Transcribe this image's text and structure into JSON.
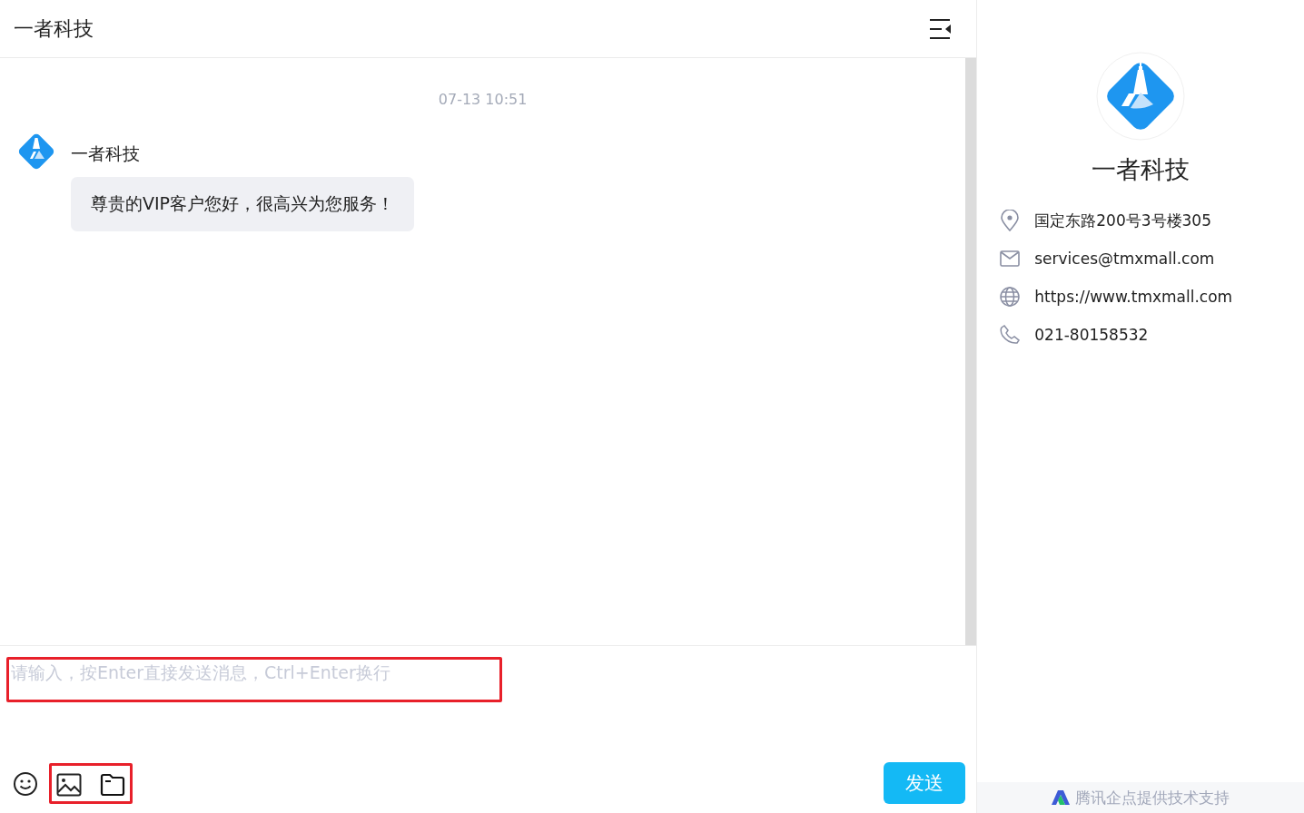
{
  "header": {
    "title": "一者科技"
  },
  "chat": {
    "timestamp": "07-13 10:51",
    "messages": [
      {
        "sender": "一者科技",
        "text": "尊贵的VIP客户您好，很高兴为您服务！"
      }
    ]
  },
  "composer": {
    "placeholder": "请输入，按Enter直接发送消息，Ctrl+Enter换行",
    "send_label": "发送"
  },
  "profile": {
    "name": "一者科技",
    "details": [
      {
        "kind": "address",
        "text": "国定东路200号3号楼305"
      },
      {
        "kind": "email",
        "text": "services@tmxmall.com"
      },
      {
        "kind": "website",
        "text": "https://www.tmxmall.com"
      },
      {
        "kind": "phone",
        "text": "021-80158532"
      }
    ]
  },
  "footer": {
    "text": "腾讯企点提供技术支持"
  }
}
